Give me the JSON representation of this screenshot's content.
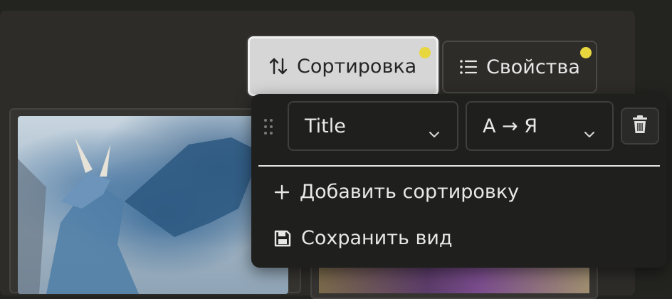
{
  "toolbar": {
    "sort_button": {
      "label": "Сортировка",
      "active": true,
      "indicator": true
    },
    "properties_button": {
      "label": "Свойства",
      "indicator": true
    }
  },
  "sort_menu": {
    "rules": [
      {
        "field": "Title",
        "direction": "А → Я"
      }
    ],
    "add_sort_label": "Добавить сортировку",
    "save_view_label": "Сохранить вид"
  },
  "colors": {
    "indicator": "#e8d63f",
    "background": "#232320",
    "panel": "#2d2c29",
    "dropdown": "#1f1f1d",
    "active_button": "#d6d6d6"
  },
  "icons": {
    "sort": "sort-arrows-icon",
    "properties": "list-icon",
    "drag": "drag-handle-icon",
    "chevron": "chevron-down-icon",
    "delete": "trash-icon",
    "add": "plus-icon",
    "save": "floppy-disk-icon"
  }
}
